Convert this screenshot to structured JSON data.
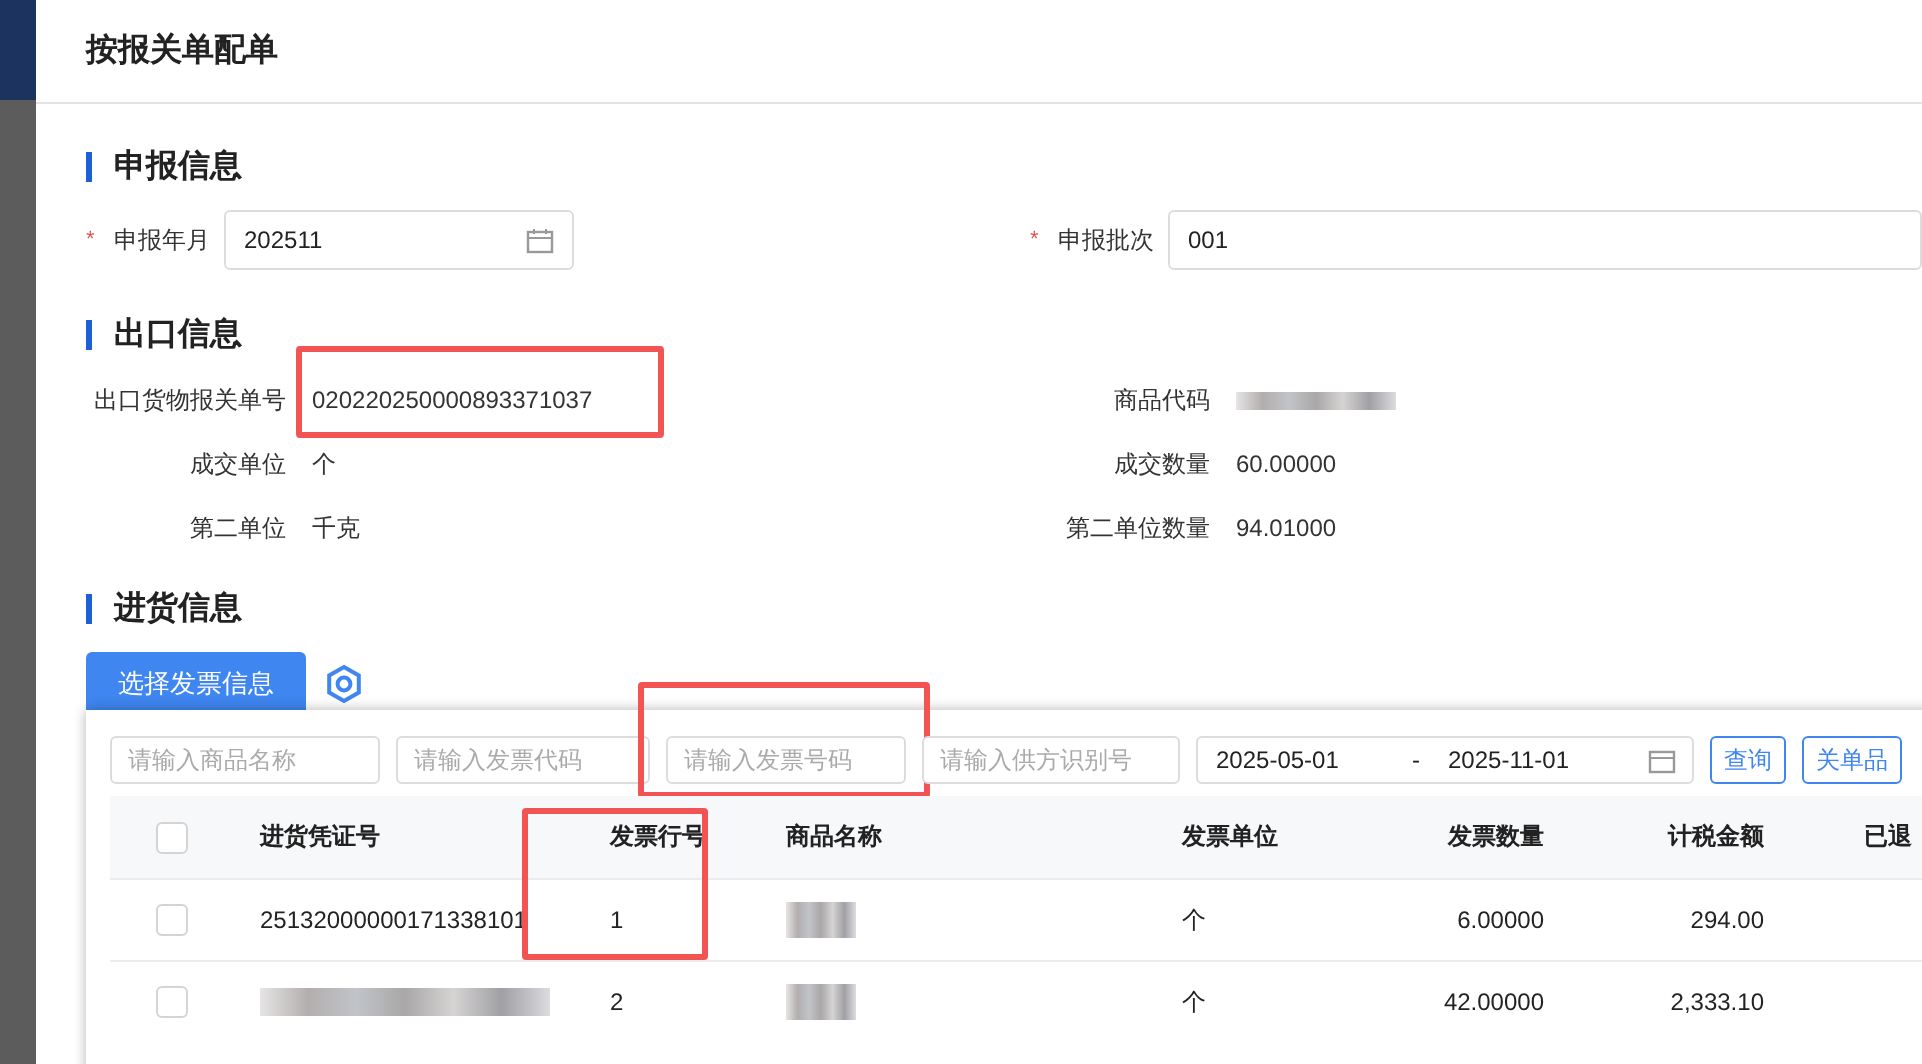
{
  "dialog": {
    "title": "按报关单配单"
  },
  "declaration": {
    "heading": "申报信息",
    "fields": [
      {
        "required": true,
        "required_mark": "*",
        "label": "申报年月",
        "value": "202511",
        "kind": "date"
      },
      {
        "required": true,
        "required_mark": "*",
        "label": "申报批次",
        "value": "001",
        "kind": "text"
      }
    ]
  },
  "export": {
    "heading": "出口信息",
    "details": [
      {
        "label": "出口货物报关单号",
        "value": "020220250000893371037",
        "blurred": false,
        "highlighted": true
      },
      {
        "label": "商品代码",
        "blurred": true,
        "highlighted": false
      },
      {
        "label": "成交单位",
        "value": "个",
        "blurred": false,
        "highlighted": false
      },
      {
        "label": "成交数量",
        "value": "60.00000",
        "blurred": false,
        "highlighted": false
      },
      {
        "label": "第二单位",
        "value": "千克",
        "blurred": false,
        "highlighted": false
      },
      {
        "label": "第二单位数量",
        "value": "94.01000",
        "blurred": false,
        "highlighted": false
      }
    ]
  },
  "purchase": {
    "heading": "进货信息",
    "select_button": "选择发票信息",
    "filters": [
      {
        "placeholder": "请输入商品名称",
        "highlighted": false
      },
      {
        "placeholder": "请输入发票代码",
        "highlighted": false
      },
      {
        "placeholder": "请输入发票号码",
        "highlighted": true
      },
      {
        "placeholder": "请输入供方识别号",
        "highlighted": false
      }
    ],
    "date_range": {
      "start": "2025-05-01",
      "separator": "-",
      "end": "2025-11-01"
    },
    "buttons": [
      "查询",
      "关单品"
    ],
    "table": {
      "select_all": {
        "checked": false
      },
      "columns": [
        {
          "label": "进货凭证号",
          "highlighted": false
        },
        {
          "label": "发票行号",
          "highlighted": true
        },
        {
          "label": "商品名称",
          "highlighted": false
        },
        {
          "label": "发票单位",
          "highlighted": false
        },
        {
          "label": "发票数量",
          "highlighted": false
        },
        {
          "label": "计税金额",
          "highlighted": false
        },
        {
          "label": "已退",
          "highlighted": false
        }
      ],
      "rows": [
        {
          "checked": false,
          "cells": [
            {
              "text": "25132000000171338101",
              "blurred": false
            },
            {
              "text": "1",
              "blurred": false
            },
            {
              "blurred": true
            },
            {
              "text": "个",
              "blurred": false
            },
            {
              "text": "6.00000",
              "blurred": false
            },
            {
              "text": "294.00",
              "blurred": false
            }
          ]
        },
        {
          "checked": false,
          "cells": [
            {
              "blurred": true
            },
            {
              "text": "2",
              "blurred": false
            },
            {
              "blurred": true
            },
            {
              "text": "个",
              "blurred": false
            },
            {
              "text": "42.00000",
              "blurred": false
            },
            {
              "text": "2,333.10",
              "blurred": false
            }
          ]
        }
      ]
    }
  }
}
